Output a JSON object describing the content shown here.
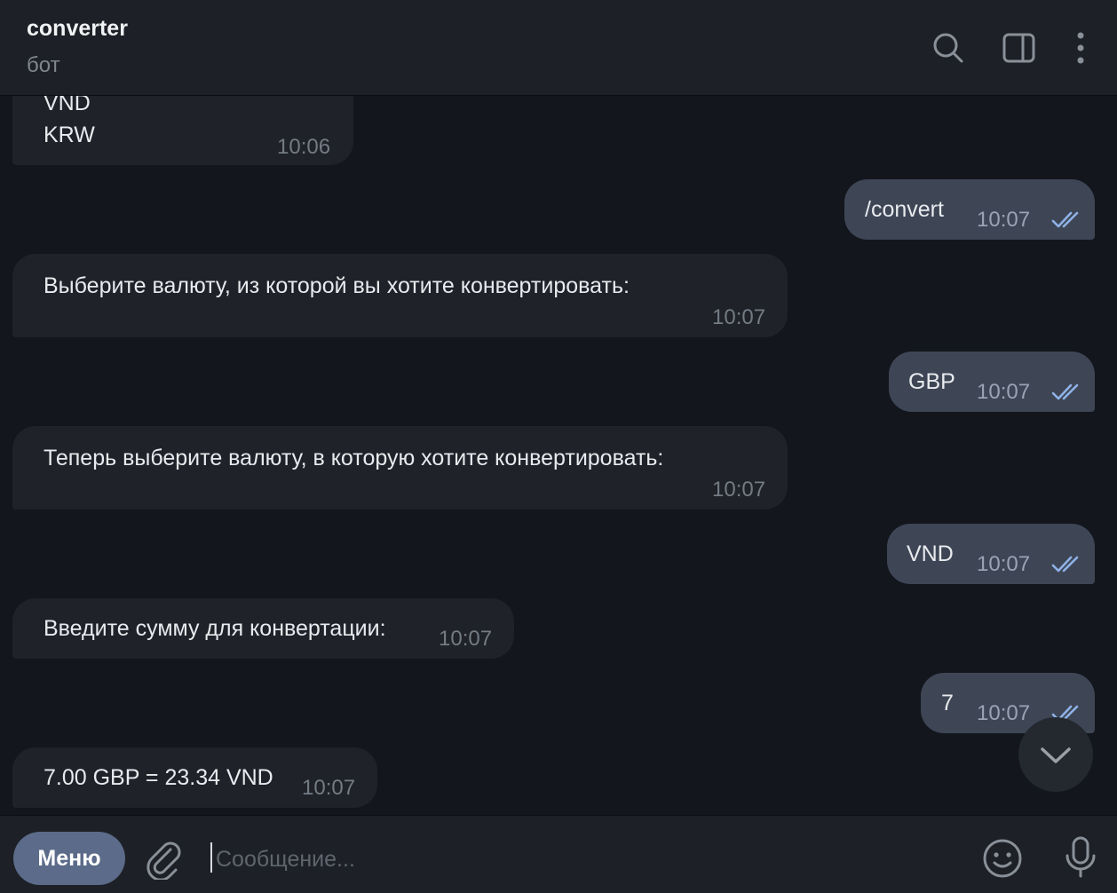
{
  "header": {
    "title": "converter",
    "subtitle": "бот",
    "icons": [
      "search-icon",
      "sidebar-toggle-icon",
      "more-vertical-icon"
    ]
  },
  "messages": [
    {
      "direction": "in",
      "text": "VND\nKRW",
      "time": "10:06"
    },
    {
      "direction": "out",
      "text": "/convert",
      "time": "10:07",
      "status": "read"
    },
    {
      "direction": "in",
      "text": "Выберите валюту, из которой вы хотите конвертировать:",
      "time": "10:07"
    },
    {
      "direction": "out",
      "text": "GBP",
      "time": "10:07",
      "status": "read"
    },
    {
      "direction": "in",
      "text": "Теперь выберите валюту, в которую хотите конвертировать:",
      "time": "10:07"
    },
    {
      "direction": "out",
      "text": "VND",
      "time": "10:07",
      "status": "read"
    },
    {
      "direction": "in",
      "text": "Введите сумму для конвертации:",
      "time": "10:07"
    },
    {
      "direction": "out",
      "text": "7",
      "time": "10:07",
      "status": "read"
    },
    {
      "direction": "in",
      "text": "7.00 GBP = 23.34 VND",
      "time": "10:07"
    }
  ],
  "input_bar": {
    "menu_label": "Меню",
    "placeholder": "Сообщение...",
    "value": ""
  },
  "colors": {
    "background": "#13161c",
    "header": "#1d2026",
    "incoming_bubble": "#1f2229",
    "outgoing_bubble": "#3e4656",
    "menu_button": "#5b6b89",
    "read_check": "#8fb2e6"
  }
}
